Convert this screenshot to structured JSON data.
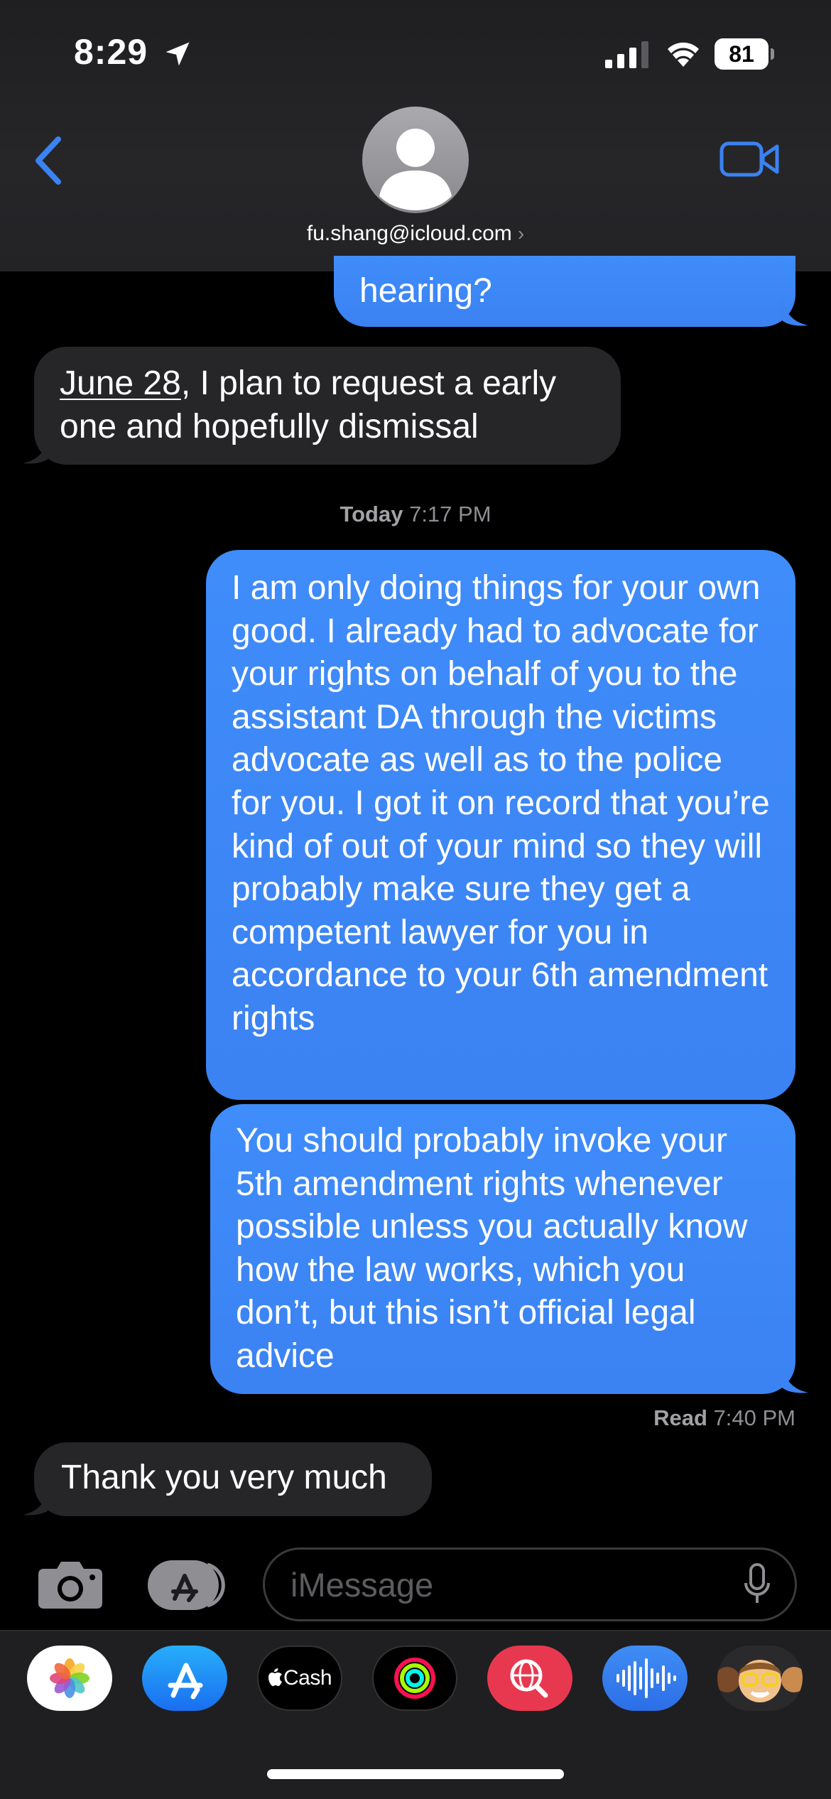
{
  "status_bar": {
    "time": "8:29",
    "battery": "81"
  },
  "header": {
    "contact": "fu.shang@icloud.com",
    "contact_chevron": "›"
  },
  "messages": {
    "partial_sent": "hearing?",
    "received_1_date": "June 28",
    "received_1_rest": ", I plan to request a early one and hopefully dismissal",
    "timestamp_day": "Today",
    "timestamp_time": "7:17 PM",
    "sent_1": "I am only doing things for your own good. I already had to advocate for your rights on behalf of you to the assistant DA through the victims advocate as well as to the police for you. I got it on record that you’re kind of out of your mind so they will probably make sure they get a competent lawyer for you in accordance to your 6th amendment rights",
    "sent_2": "You should probably invoke your 5th amendment rights whenever possible unless you actually know how the law works, which you don’t, but this isn’t official legal advice",
    "read_label": "Read",
    "read_time": "7:40 PM",
    "received_2": "Thank you very much"
  },
  "input": {
    "placeholder": "iMessage"
  },
  "app_drawer": {
    "items": [
      {
        "name": "photos-icon"
      },
      {
        "name": "app-store-icon"
      },
      {
        "name": "apple-cash-icon",
        "label": "Cash"
      },
      {
        "name": "fitness-icon"
      },
      {
        "name": "web-search-icon"
      },
      {
        "name": "audio-message-icon"
      },
      {
        "name": "memoji-icon"
      }
    ]
  },
  "colors": {
    "sent_bubble": "#3b82f2",
    "received_bubble": "#262629",
    "accent": "#0a84ff",
    "background": "#000000"
  }
}
